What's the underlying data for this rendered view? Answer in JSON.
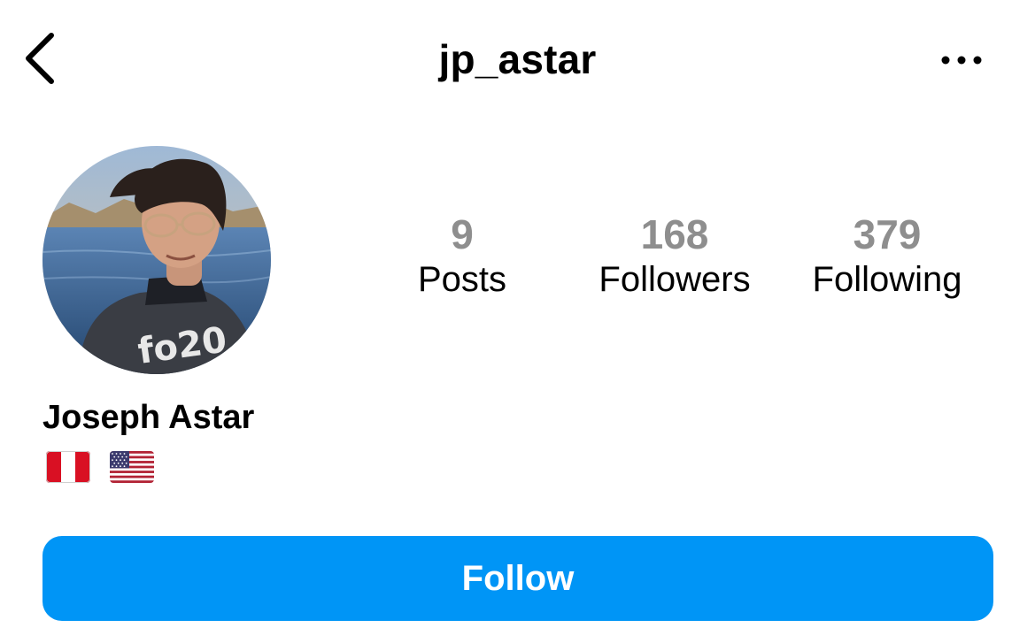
{
  "header": {
    "username": "jp_astar",
    "back_icon": "chevron-left-icon",
    "more_icon": "more-horizontal-icon"
  },
  "profile": {
    "avatar": "profile-photo",
    "full_name": "Joseph Astar",
    "bio_flags": [
      "flag-peru-icon",
      "flag-usa-icon"
    ]
  },
  "stats": [
    {
      "value": "9",
      "label": "Posts"
    },
    {
      "value": "168",
      "label": "Followers"
    },
    {
      "value": "379",
      "label": "Following"
    }
  ],
  "actions": {
    "follow_label": "Follow"
  },
  "colors": {
    "accent": "#0095f6",
    "stat_value": "#8e8e8e",
    "text": "#000000",
    "background": "#ffffff"
  }
}
